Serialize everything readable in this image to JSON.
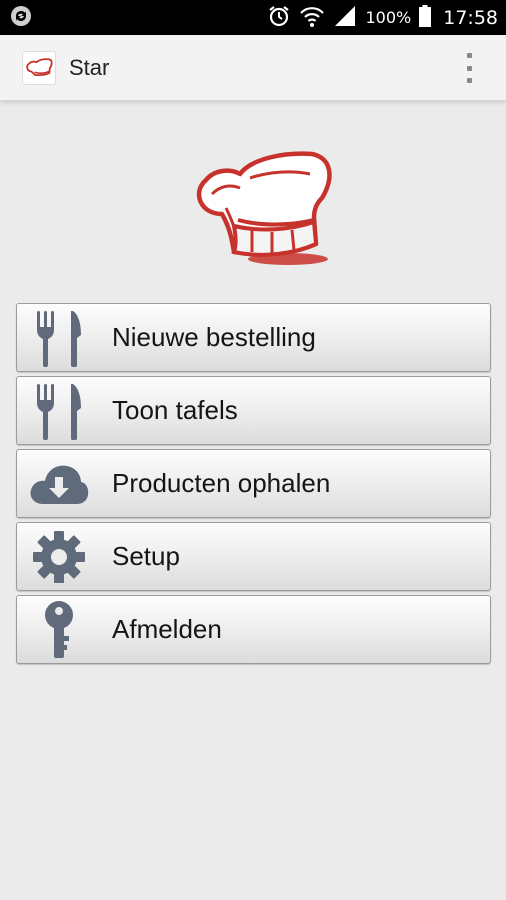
{
  "status_bar": {
    "battery": "100%",
    "time": "17:58",
    "icons": [
      "sync-icon",
      "alarm-icon",
      "wifi-icon",
      "signal-icon",
      "battery-icon"
    ]
  },
  "app_bar": {
    "title": "Star",
    "logo_icon": "chef-hat-icon",
    "overflow_icon": "more-vert-icon"
  },
  "hero": {
    "icon": "chef-hat-icon",
    "color": "#c8322d"
  },
  "menu": {
    "items": [
      {
        "label": "Nieuwe bestelling",
        "icon": "fork-knife-icon"
      },
      {
        "label": "Toon tafels",
        "icon": "fork-knife-icon"
      },
      {
        "label": "Producten ophalen",
        "icon": "cloud-download-icon"
      },
      {
        "label": "Setup",
        "icon": "gear-icon"
      },
      {
        "label": "Afmelden",
        "icon": "key-icon"
      }
    ],
    "icon_color": "#5f6a7a"
  }
}
